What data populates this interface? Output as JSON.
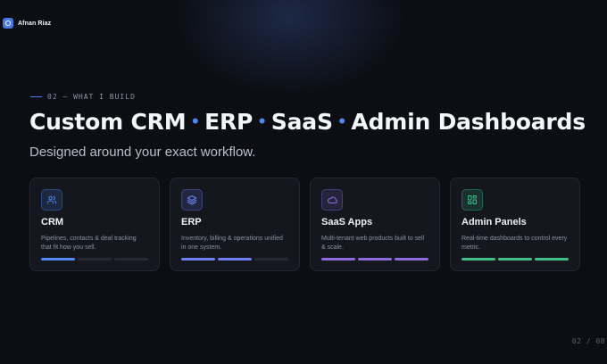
{
  "brand": {
    "name": "Afnan Riaz",
    "icon": "logo-icon"
  },
  "section": {
    "eyebrow": "02 — WHAT I BUILD"
  },
  "headline": {
    "parts": [
      "Custom CRM",
      "ERP",
      "SaaS",
      "Admin Dashboards"
    ],
    "separator": "•"
  },
  "subheading": "Designed around your exact workflow.",
  "colors": {
    "accent": "#4f86f0",
    "background": "#0c0e13",
    "card": "#14171e",
    "purple": "#8b6bdc",
    "green": "#3fbf86"
  },
  "cards": [
    {
      "title": "CRM",
      "description": "Pipelines, contacts & deal tracking that fit how you sell.",
      "icon": "users-icon",
      "accent": "#4f86f0",
      "progress_segments": [
        true,
        false,
        false
      ]
    },
    {
      "title": "ERP",
      "description": "Inventory, billing & operations unified in one system.",
      "icon": "layers-icon",
      "accent": "#6e7df0",
      "progress_segments": [
        true,
        true,
        false
      ]
    },
    {
      "title": "SaaS Apps",
      "description": "Multi-tenant web products built to sell & scale.",
      "icon": "cloud-icon",
      "accent": "#8b6bdc",
      "progress_segments": [
        true,
        true,
        true
      ]
    },
    {
      "title": "Admin Panels",
      "description": "Real-time dashboards to control every metric.",
      "icon": "dashboard-icon",
      "accent": "#3fbf86",
      "progress_segments": [
        true,
        true,
        true
      ]
    }
  ],
  "pager": "02 / 08"
}
